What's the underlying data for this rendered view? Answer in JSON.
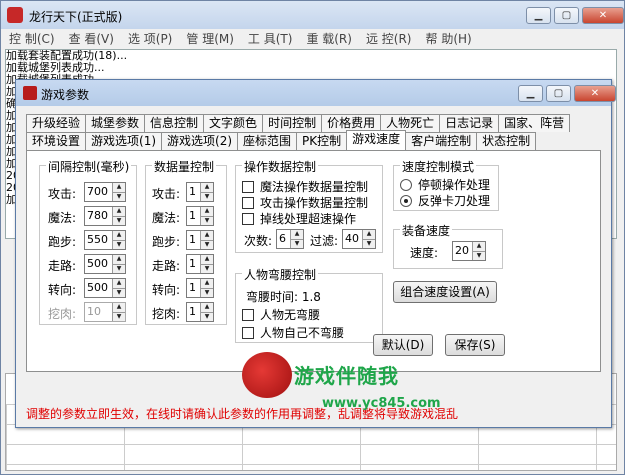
{
  "main_window": {
    "title": "龙行天下(正式版)",
    "menu": [
      "控 制(C)",
      "查 看(V)",
      "选 项(P)",
      "管 理(M)",
      "工 具(T)",
      "重 载(R)",
      "远 控(R)",
      "帮 助(H)"
    ],
    "log_lines": [
      "加载套装配置成功(18)...",
      "加载城堡列表成功...",
      "加载城堡列表成功...",
      "加",
      "确",
      "加",
      "加",
      "加",
      "加",
      "加",
      "20",
      "20",
      "加"
    ]
  },
  "dialog": {
    "title": "游戏参数",
    "tabs_row1": [
      "升级经验",
      "城堡参数",
      "信息控制",
      "文字颜色",
      "时间控制",
      "价格费用",
      "人物死亡",
      "日志记录",
      "国家、阵营"
    ],
    "tabs_row2": [
      "环境设置",
      "游戏选项(1)",
      "游戏选项(2)",
      "座标范围",
      "PK控制",
      "游戏速度",
      "客户端控制",
      "状态控制"
    ],
    "active_tab": "游戏速度",
    "interval_group": {
      "title": "间隔控制(毫秒)",
      "rows": [
        {
          "label": "攻击:",
          "value": "700"
        },
        {
          "label": "魔法:",
          "value": "780"
        },
        {
          "label": "跑步:",
          "value": "550"
        },
        {
          "label": "走路:",
          "value": "500"
        },
        {
          "label": "转向:",
          "value": "500"
        },
        {
          "label": "挖肉:",
          "value": "10"
        }
      ]
    },
    "quantity_group": {
      "title": "数据量控制",
      "rows": [
        {
          "label": "攻击:",
          "value": "1"
        },
        {
          "label": "魔法:",
          "value": "1"
        },
        {
          "label": "跑步:",
          "value": "1"
        },
        {
          "label": "走路:",
          "value": "1"
        },
        {
          "label": "转向:",
          "value": "1"
        },
        {
          "label": "挖肉:",
          "value": "1"
        }
      ]
    },
    "operation_group": {
      "title": "操作数据控制",
      "checks": [
        "魔法操作数据量控制",
        "攻击操作数据量控制",
        "掉线处理超速操作"
      ],
      "count_label": "次数:",
      "count_value": "6",
      "filter_label": "过滤:",
      "filter_value": "40"
    },
    "stoop_group": {
      "title": "人物弯腰控制",
      "row1": "弯腰时间:  1.8",
      "row2": "人物无弯腰",
      "row3": "人物自己不弯腰"
    },
    "speed_mode_group": {
      "title": "速度控制模式",
      "options": [
        "停顿操作处理",
        "反弹卡刀处理"
      ],
      "selected": 1
    },
    "equip_speed_group": {
      "title": "装备速度",
      "label": "速度:",
      "value": "20"
    },
    "buttons": {
      "combo": "组合速度设置(A)",
      "default": "默认(D)",
      "save": "保存(S)"
    },
    "warning": "调整的参数立即生效，在线时请确认此参数的作用再调整，乱调整将导致游戏混乱",
    "watermark": {
      "text": "游戏伴随我",
      "url": "www.yc845.com"
    }
  }
}
